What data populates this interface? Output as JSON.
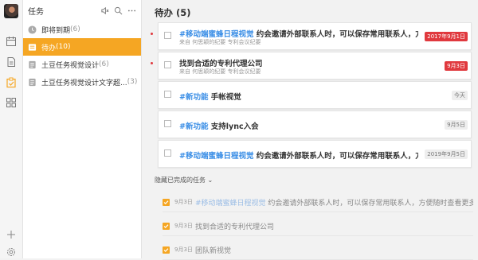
{
  "sidebar": {
    "icons": [
      "calendar-icon",
      "note-icon",
      "task-icon",
      "apps-icon",
      "add-icon",
      "settings-icon"
    ]
  },
  "panel": {
    "title": "任务",
    "items": [
      {
        "label": "即将到期",
        "count": "(6)",
        "icon": "clock-icon",
        "active": false
      },
      {
        "label": "待办",
        "count": "(10)",
        "icon": "inbox-icon",
        "active": true
      },
      {
        "label": "土豆任务视觉设计",
        "count": "(6)",
        "icon": "list-icon",
        "active": false
      },
      {
        "label": "土豆任务视觉设计文字超...",
        "count": "(3)",
        "icon": "list-icon",
        "active": false
      }
    ]
  },
  "main": {
    "title": "待办 (5)",
    "tasks": [
      {
        "tag": "#移动端蜜蜂日程视觉",
        "text": "约会邀请外部联系人时，可以保存常用联系人，方便以后...",
        "sub": "来自 何思颖的纪要 专利会议纪要",
        "badge": "2017年9月1日",
        "badge_color": "red",
        "unread": true
      },
      {
        "tag": "",
        "text": "找到合适的专利代理公司",
        "sub": "来自 何思颖的纪要 专利会议纪要",
        "badge": "9月3日",
        "badge_color": "red",
        "unread": true
      },
      {
        "tag": "#新功能",
        "text": "手帐视觉",
        "sub": "",
        "badge": "今天",
        "badge_color": "gray",
        "unread": false
      },
      {
        "tag": "#新功能",
        "text": "支持lync入会",
        "sub": "",
        "badge": "9月5日",
        "badge_color": "gray",
        "unread": false
      },
      {
        "tag": "#移动端蜜蜂日程视觉",
        "text": "约会邀请外部联系人时，可以保存常用联系人，方便以后...",
        "sub": "",
        "badge": "2019年9月5日",
        "badge_color": "gray",
        "unread": false
      }
    ],
    "hidden_label": "隐藏已完成的任务",
    "completed": [
      {
        "date": "9月3日",
        "tag": "#移动端蜜蜂日程视觉",
        "text": "约会邀请外部联系人时，可以保存常用联系人，方便随时查看更多..."
      },
      {
        "date": "9月3日",
        "tag": "",
        "text": "找到合适的专利代理公司"
      },
      {
        "date": "9月3日",
        "tag": "",
        "text": "团队新视觉"
      }
    ]
  },
  "colors": {
    "accent": "#f5a623",
    "tag_blue": "#3a8ee6",
    "overdue_red": "#e0393e"
  }
}
